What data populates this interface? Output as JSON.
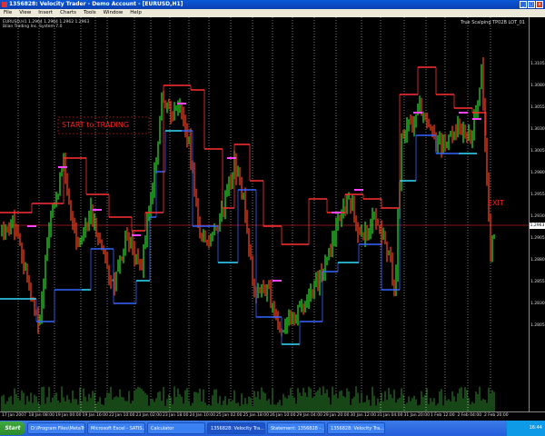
{
  "window": {
    "title": "1356828: Velocity Trader - Demo Account - [EURUSD,H1]",
    "buttons": [
      "_",
      "□",
      "x"
    ]
  },
  "menu": [
    "File",
    "View",
    "Insert",
    "Charts",
    "Tools",
    "Window",
    "Help"
  ],
  "chart": {
    "symbol_line": "EURUSD,H1  1.2964 1.2964 1.2962 1.2963",
    "indicator_line": "Bilan Trading Inc. System 7.0",
    "right_indicator": "True Scalping TP02B LOT_01",
    "annotation_start": "START to TRADING",
    "annotation_exit": "EXIT",
    "colors": {
      "bull": "#22c522",
      "bear": "#e03a1a",
      "support": "#3366ff",
      "resistance": "#ff3030",
      "level": "#b52020"
    }
  },
  "price_axis": {
    "labels": [
      "1.3105",
      "1.3080",
      "1.3055",
      "1.3030",
      "1.3005",
      "1.2980",
      "1.2955",
      "1.2930",
      "1.2905",
      "1.2880",
      "1.2855",
      "1.2830",
      "1.2805"
    ],
    "current": "1.2963"
  },
  "time_axis": {
    "labels": [
      "17 Jan 2007",
      "18 Jan 08:00",
      "19 Jan 00:00",
      "19 Jan 16:00",
      "22 Jan 10:00",
      "23 Jan 02:00",
      "23 Jan 18:00",
      "24 Jan 10:00",
      "25 Jan 02:00",
      "25 Jan 18:00",
      "26 Jan 10:00",
      "29 Jan 04:00",
      "29 Jan 20:00",
      "30 Jan 12:00",
      "31 Jan 04:00",
      "31 Jan 20:00",
      "1 Feb 12:00",
      "2 Feb 04:00",
      "2 Feb 20:00"
    ]
  },
  "taskbar": {
    "start": "Start",
    "tasks": [
      "D:\\Program Files\\MetaTr...",
      "Microsoft Excel - SATIS...",
      "Calculator",
      "1356828: Velocity Tra...",
      "Statement: 1356828 - ...",
      "1356828: Velocity Tra..."
    ],
    "clock": "16:44"
  }
}
